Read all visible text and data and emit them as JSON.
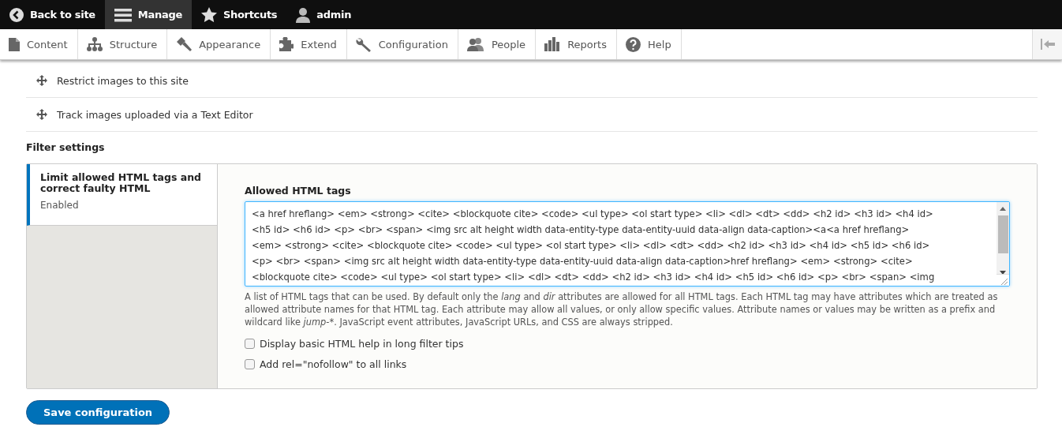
{
  "toolbar": {
    "items": [
      {
        "label": "Back to site",
        "selected": false
      },
      {
        "label": "Manage",
        "selected": true
      },
      {
        "label": "Shortcuts",
        "selected": false
      },
      {
        "label": "admin",
        "selected": false
      }
    ]
  },
  "tray": {
    "items": [
      "Content",
      "Structure",
      "Appearance",
      "Extend",
      "Configuration",
      "People",
      "Reports",
      "Help"
    ]
  },
  "filter_rows": [
    "Restrict images to this site",
    "Track images uploaded via a Text Editor"
  ],
  "filter_settings": {
    "heading": "Filter settings",
    "tabs": [
      {
        "title": "Limit allowed HTML tags and correct faulty HTML",
        "summary": "Enabled",
        "selected": true
      }
    ],
    "field_label": "Allowed HTML tags",
    "value_lines": [
      "<a href hreflang> <em> <strong> <cite> <blockquote cite> <code> <ul type> <ol start type> <li> <dl> <dt> <dd> <h2 id> <h3 id> <h4 id>",
      "<h5 id> <h6 id> <p> <br> <span> <img src alt height width data-entity-type data-entity-uuid data-align data-caption><a<a href hreflang>",
      "<em> <strong> <cite> <blockquote cite> <code> <ul type> <ol start type> <li> <dl> <dt> <dd> <h2 id> <h3 id> <h4 id> <h5 id> <h6 id>",
      "<p> <br> <span> <img src alt height width data-entity-type data-entity-uuid data-align data-caption>href hreflang> <em> <strong> <cite>",
      "<blockquote cite> <code> <ul type> <ol start type> <li> <dl> <dt> <dd> <h2 id> <h3 id> <h4 id> <h5 id> <h6 id> <p> <br> <span> <img"
    ],
    "description": [
      {
        "text": "A list of HTML tags that can be used. By default only the ",
        "italic": false
      },
      {
        "text": "lang",
        "italic": true
      },
      {
        "text": " and ",
        "italic": false
      },
      {
        "text": "dir",
        "italic": true
      },
      {
        "text": " attributes are allowed for all HTML tags. Each HTML tag may have attributes which are treated as allowed attribute names for that HTML tag. Each attribute may allow all values, or only allow specific values. Attribute names or values may be written as a prefix and wildcard like ",
        "italic": false
      },
      {
        "text": "jump-*",
        "italic": true
      },
      {
        "text": ". JavaScript event attributes, JavaScript URLs, and CSS are always stripped.",
        "italic": false
      }
    ],
    "checkboxes": [
      {
        "label": "Display basic HTML help in long filter tips",
        "checked": false
      },
      {
        "label": "Add rel=\"nofollow\" to all links",
        "checked": false
      }
    ]
  },
  "save_button": "Save configuration"
}
